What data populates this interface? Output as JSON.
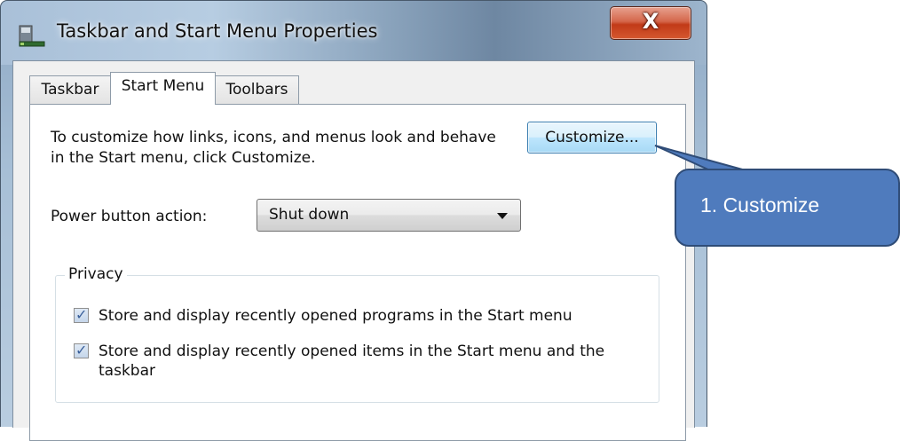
{
  "window": {
    "title": "Taskbar and Start Menu Properties",
    "close_glyph": "X",
    "app_icon": "taskbar-properties-icon"
  },
  "tabs": [
    {
      "label": "Taskbar",
      "active": false
    },
    {
      "label": "Start Menu",
      "active": true
    },
    {
      "label": "Toolbars",
      "active": false
    }
  ],
  "start_menu": {
    "description": "To customize how links, icons, and menus look and behave in the Start menu, click Customize.",
    "customize_button": "Customize...",
    "power_label": "Power button action:",
    "power_value": "Shut down",
    "privacy": {
      "legend": "Privacy",
      "items": [
        {
          "label": "Store and display recently opened programs in the Start menu",
          "checked": true
        },
        {
          "label": "Store and display recently opened items in the Start menu and the taskbar",
          "checked": true
        }
      ]
    }
  },
  "callout": {
    "text": "1. Customize",
    "fill": "#4f7bbd",
    "border": "#2f4c77"
  },
  "colors": {
    "button_hover": "#bee6fd",
    "close_red": "#c23a18"
  }
}
